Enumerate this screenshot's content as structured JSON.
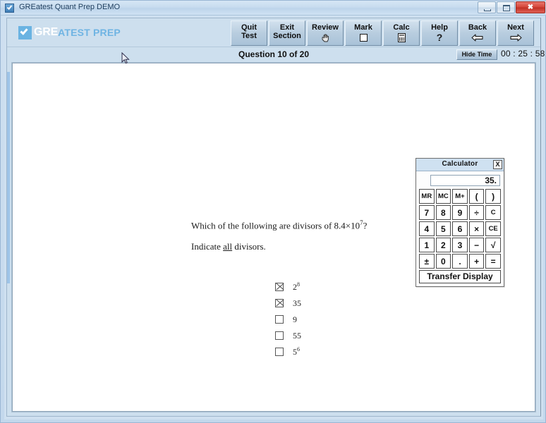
{
  "window": {
    "title": "GREatest Quant Prep DEMO",
    "icon": "app-check-icon",
    "buttons": {
      "minimize": "minimize-icon",
      "maximize": "maximize-icon",
      "close": "close-icon"
    }
  },
  "brand": {
    "part1": "GRE",
    "part2": "ATEST PREP",
    "check_icon": "check-logo-icon",
    "accent": "#6ab3e2"
  },
  "toolbar": {
    "buttons": [
      {
        "line1": "Quit",
        "line2": "Test",
        "icon": ""
      },
      {
        "line1": "Exit",
        "line2": "Section",
        "icon": ""
      },
      {
        "line1": "Review",
        "line2": "",
        "icon": "hand-pointer-icon"
      },
      {
        "line1": "Mark",
        "line2": "",
        "icon": "checkbox-icon"
      },
      {
        "line1": "Calc",
        "line2": "",
        "icon": "calculator-icon"
      },
      {
        "line1": "Help",
        "line2": "",
        "icon": "question-mark-icon"
      },
      {
        "line1": "Back",
        "line2": "",
        "icon": "arrow-left-icon"
      },
      {
        "line1": "Next",
        "line2": "",
        "icon": "arrow-right-icon"
      }
    ]
  },
  "question_bar": {
    "title": "Question 10 of 20",
    "hide_time_label": "Hide Time",
    "timer": "00 : 25 : 58"
  },
  "question": {
    "stem_pre": "Which of the following are divisors of 8.4×10",
    "stem_exp": "7",
    "stem_post": "?",
    "instruction_pre": "Indicate ",
    "instruction_em": "all",
    "instruction_post": " divisors.",
    "choices": [
      {
        "label": "2",
        "exp": "8",
        "checked": true
      },
      {
        "label": "35",
        "exp": "",
        "checked": true
      },
      {
        "label": "9",
        "exp": "",
        "checked": false
      },
      {
        "label": "55",
        "exp": "",
        "checked": false
      },
      {
        "label": "5",
        "exp": "6",
        "checked": false
      }
    ]
  },
  "calculator": {
    "title": "Calculator",
    "close_label": "X",
    "display": "35.",
    "rows": [
      [
        "MR",
        "MC",
        "M+",
        "(",
        ")"
      ],
      [
        "7",
        "8",
        "9",
        "÷",
        "C"
      ],
      [
        "4",
        "5",
        "6",
        "×",
        "CE"
      ],
      [
        "1",
        "2",
        "3",
        "−",
        "√"
      ],
      [
        "±",
        "0",
        ".",
        "+",
        "="
      ]
    ],
    "transfer_label": "Transfer Display"
  },
  "cursor": {
    "name": "mouse-pointer"
  }
}
